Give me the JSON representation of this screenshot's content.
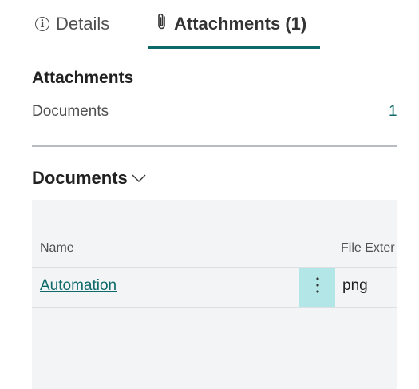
{
  "tabs": {
    "details_label": "Details",
    "attachments_label": "Attachments (1)"
  },
  "factbox": {
    "title": "Attachments",
    "documents_label": "Documents",
    "documents_count": "1"
  },
  "documents": {
    "header": "Documents",
    "columns": {
      "name": "Name",
      "file_extension": "File Exter"
    },
    "rows": [
      {
        "name": "Automation",
        "file_extension": "png"
      }
    ]
  },
  "colors": {
    "accent": "#0e6a6a",
    "selected_cell": "#b3e6e6",
    "grid_background": "#f3f4f6"
  }
}
